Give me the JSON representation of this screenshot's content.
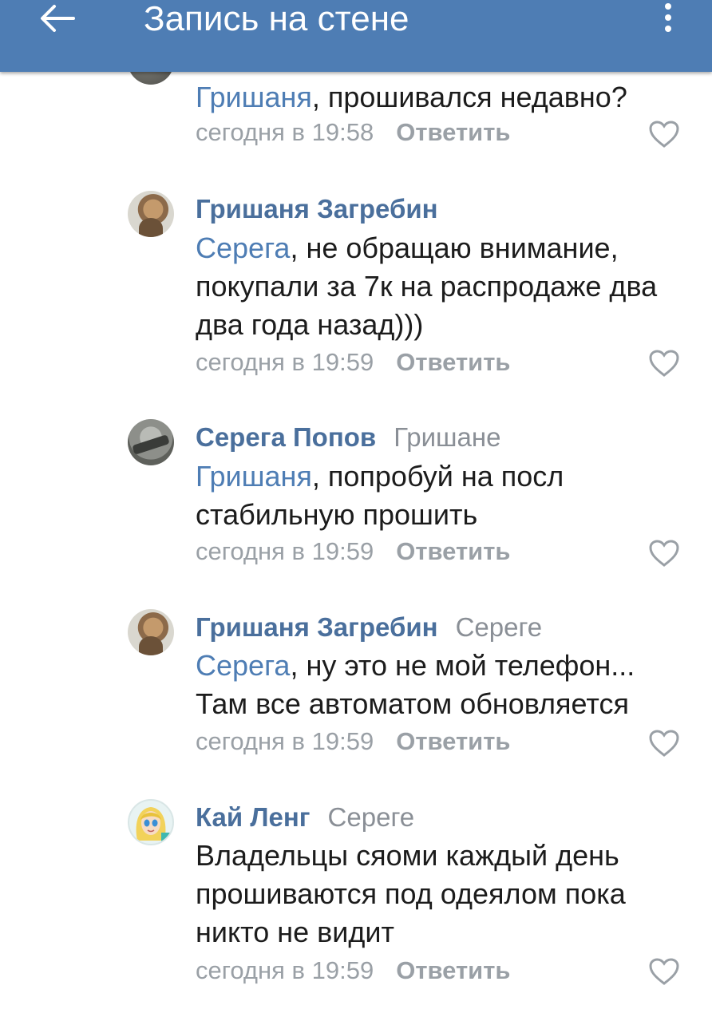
{
  "header": {
    "title": "Запись на стене",
    "color": "#4e7db4"
  },
  "icons": {
    "back": "arrow-left-icon",
    "menu": "more-vertical-icon",
    "like": "heart-outline-icon"
  },
  "comments": [
    {
      "mention": "Гришаня",
      "text": ", прошивался недавно?",
      "time": "сегодня в 19:58",
      "reply_label": "Ответить"
    },
    {
      "author": "Гришаня Загребин",
      "mention": "Серега",
      "text": ", не обращаю внимание,",
      "text2": "покупали за 7к на распродаже два",
      "text3": "два года назад)))",
      "time": "сегодня в 19:59",
      "reply_label": "Ответить"
    },
    {
      "author": "Серега Попов",
      "reply_to": "Гришане",
      "mention": "Гришаня",
      "text": ", попробуй на посл",
      "text2": "стабильную прошить",
      "time": "сегодня в 19:59",
      "reply_label": "Ответить"
    },
    {
      "author": "Гришаня Загребин",
      "reply_to": "Сереге",
      "mention": "Серега",
      "text": ", ну это не мой телефон...",
      "text2": "Там все автоматом обновляется",
      "time": "сегодня в 19:59",
      "reply_label": "Ответить"
    },
    {
      "author": "Кай Ленг",
      "reply_to": "Сереге",
      "text": "Владельцы сяоми каждый день",
      "text2": "прошиваются под одеялом пока",
      "text3": "никто не видит",
      "time": "сегодня в 19:59",
      "reply_label": "Ответить"
    }
  ]
}
